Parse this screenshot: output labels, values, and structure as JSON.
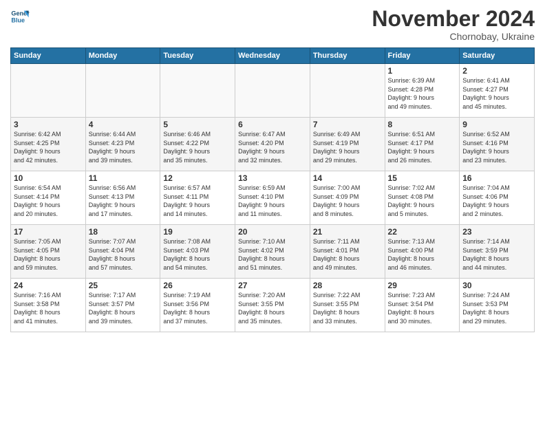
{
  "logo": {
    "line1": "General",
    "line2": "Blue"
  },
  "title": "November 2024",
  "subtitle": "Chornobay, Ukraine",
  "days_header": [
    "Sunday",
    "Monday",
    "Tuesday",
    "Wednesday",
    "Thursday",
    "Friday",
    "Saturday"
  ],
  "weeks": [
    [
      {
        "day": "",
        "info": ""
      },
      {
        "day": "",
        "info": ""
      },
      {
        "day": "",
        "info": ""
      },
      {
        "day": "",
        "info": ""
      },
      {
        "day": "",
        "info": ""
      },
      {
        "day": "1",
        "info": "Sunrise: 6:39 AM\nSunset: 4:28 PM\nDaylight: 9 hours\nand 49 minutes."
      },
      {
        "day": "2",
        "info": "Sunrise: 6:41 AM\nSunset: 4:27 PM\nDaylight: 9 hours\nand 45 minutes."
      }
    ],
    [
      {
        "day": "3",
        "info": "Sunrise: 6:42 AM\nSunset: 4:25 PM\nDaylight: 9 hours\nand 42 minutes."
      },
      {
        "day": "4",
        "info": "Sunrise: 6:44 AM\nSunset: 4:23 PM\nDaylight: 9 hours\nand 39 minutes."
      },
      {
        "day": "5",
        "info": "Sunrise: 6:46 AM\nSunset: 4:22 PM\nDaylight: 9 hours\nand 35 minutes."
      },
      {
        "day": "6",
        "info": "Sunrise: 6:47 AM\nSunset: 4:20 PM\nDaylight: 9 hours\nand 32 minutes."
      },
      {
        "day": "7",
        "info": "Sunrise: 6:49 AM\nSunset: 4:19 PM\nDaylight: 9 hours\nand 29 minutes."
      },
      {
        "day": "8",
        "info": "Sunrise: 6:51 AM\nSunset: 4:17 PM\nDaylight: 9 hours\nand 26 minutes."
      },
      {
        "day": "9",
        "info": "Sunrise: 6:52 AM\nSunset: 4:16 PM\nDaylight: 9 hours\nand 23 minutes."
      }
    ],
    [
      {
        "day": "10",
        "info": "Sunrise: 6:54 AM\nSunset: 4:14 PM\nDaylight: 9 hours\nand 20 minutes."
      },
      {
        "day": "11",
        "info": "Sunrise: 6:56 AM\nSunset: 4:13 PM\nDaylight: 9 hours\nand 17 minutes."
      },
      {
        "day": "12",
        "info": "Sunrise: 6:57 AM\nSunset: 4:11 PM\nDaylight: 9 hours\nand 14 minutes."
      },
      {
        "day": "13",
        "info": "Sunrise: 6:59 AM\nSunset: 4:10 PM\nDaylight: 9 hours\nand 11 minutes."
      },
      {
        "day": "14",
        "info": "Sunrise: 7:00 AM\nSunset: 4:09 PM\nDaylight: 9 hours\nand 8 minutes."
      },
      {
        "day": "15",
        "info": "Sunrise: 7:02 AM\nSunset: 4:08 PM\nDaylight: 9 hours\nand 5 minutes."
      },
      {
        "day": "16",
        "info": "Sunrise: 7:04 AM\nSunset: 4:06 PM\nDaylight: 9 hours\nand 2 minutes."
      }
    ],
    [
      {
        "day": "17",
        "info": "Sunrise: 7:05 AM\nSunset: 4:05 PM\nDaylight: 8 hours\nand 59 minutes."
      },
      {
        "day": "18",
        "info": "Sunrise: 7:07 AM\nSunset: 4:04 PM\nDaylight: 8 hours\nand 57 minutes."
      },
      {
        "day": "19",
        "info": "Sunrise: 7:08 AM\nSunset: 4:03 PM\nDaylight: 8 hours\nand 54 minutes."
      },
      {
        "day": "20",
        "info": "Sunrise: 7:10 AM\nSunset: 4:02 PM\nDaylight: 8 hours\nand 51 minutes."
      },
      {
        "day": "21",
        "info": "Sunrise: 7:11 AM\nSunset: 4:01 PM\nDaylight: 8 hours\nand 49 minutes."
      },
      {
        "day": "22",
        "info": "Sunrise: 7:13 AM\nSunset: 4:00 PM\nDaylight: 8 hours\nand 46 minutes."
      },
      {
        "day": "23",
        "info": "Sunrise: 7:14 AM\nSunset: 3:59 PM\nDaylight: 8 hours\nand 44 minutes."
      }
    ],
    [
      {
        "day": "24",
        "info": "Sunrise: 7:16 AM\nSunset: 3:58 PM\nDaylight: 8 hours\nand 41 minutes."
      },
      {
        "day": "25",
        "info": "Sunrise: 7:17 AM\nSunset: 3:57 PM\nDaylight: 8 hours\nand 39 minutes."
      },
      {
        "day": "26",
        "info": "Sunrise: 7:19 AM\nSunset: 3:56 PM\nDaylight: 8 hours\nand 37 minutes."
      },
      {
        "day": "27",
        "info": "Sunrise: 7:20 AM\nSunset: 3:55 PM\nDaylight: 8 hours\nand 35 minutes."
      },
      {
        "day": "28",
        "info": "Sunrise: 7:22 AM\nSunset: 3:55 PM\nDaylight: 8 hours\nand 33 minutes."
      },
      {
        "day": "29",
        "info": "Sunrise: 7:23 AM\nSunset: 3:54 PM\nDaylight: 8 hours\nand 30 minutes."
      },
      {
        "day": "30",
        "info": "Sunrise: 7:24 AM\nSunset: 3:53 PM\nDaylight: 8 hours\nand 29 minutes."
      }
    ]
  ]
}
